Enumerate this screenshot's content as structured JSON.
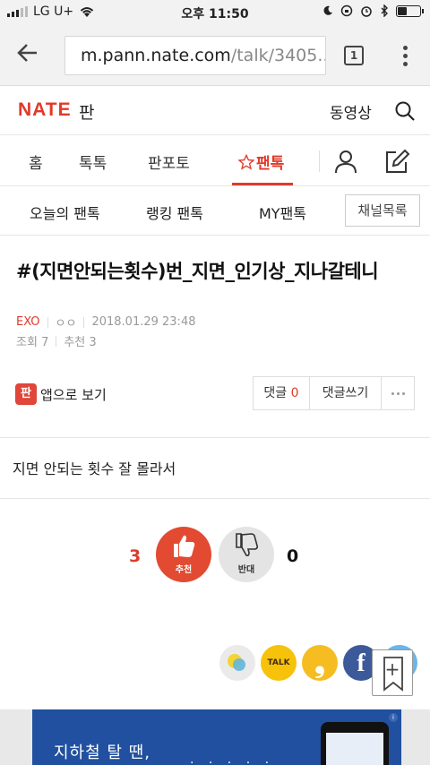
{
  "status_bar": {
    "carrier": "LG U+",
    "time": "오후 11:50"
  },
  "browser": {
    "url_host": "m.pann.nate.com",
    "url_path": "/talk/3405...",
    "tab_count": "1"
  },
  "header": {
    "logo": "NATE",
    "logo_section": "판",
    "video_link": "동영상"
  },
  "main_nav": {
    "items": [
      {
        "label": "홈"
      },
      {
        "label": "톡톡"
      },
      {
        "label": "판포토"
      },
      {
        "label": "팬톡"
      }
    ]
  },
  "sub_nav": {
    "items": [
      {
        "label": "오늘의 팬톡"
      },
      {
        "label": "랭킹 팬톡"
      },
      {
        "label": "MY팬톡"
      }
    ],
    "channel_list": "채널목록"
  },
  "post": {
    "title": "#(지면안되는횟수)번_지면_인기상_지나갈테니",
    "channel": "EXO",
    "author": "ㅇㅇ",
    "datetime": "2018.01.29 23:48",
    "views_label": "조회",
    "views": "7",
    "recommends_label": "추천",
    "recommends": "3",
    "body": "지면 안되는 횟수 잘 몰라서"
  },
  "actions": {
    "app_view": "앱으로 보기",
    "app_icon_glyph": "판",
    "comment_label": "댓글",
    "comment_count": "0",
    "write_comment": "댓글쓰기"
  },
  "vote": {
    "up_count": "3",
    "up_label": "추천",
    "down_label": "반대",
    "down_count": "0"
  },
  "share": {
    "kakao_label": "TALK",
    "story_glyph": "❟",
    "facebook_glyph": "f",
    "bookmark_glyph": "+"
  },
  "ad": {
    "text": "지하철 탈 땐,",
    "dots": "· · · · ·",
    "info_glyph": "i"
  },
  "colors": {
    "brand_red": "#e03a2a",
    "up_vote": "#e24a32",
    "kakao": "#f7c20a",
    "facebook": "#3c5a99",
    "ad_blue": "#20509f"
  },
  "icons": {
    "back": "arrow-left-icon",
    "search": "search-icon",
    "favorite": "star-icon",
    "user": "user-icon",
    "write": "edit-icon",
    "bookmark": "bookmark-icon"
  }
}
